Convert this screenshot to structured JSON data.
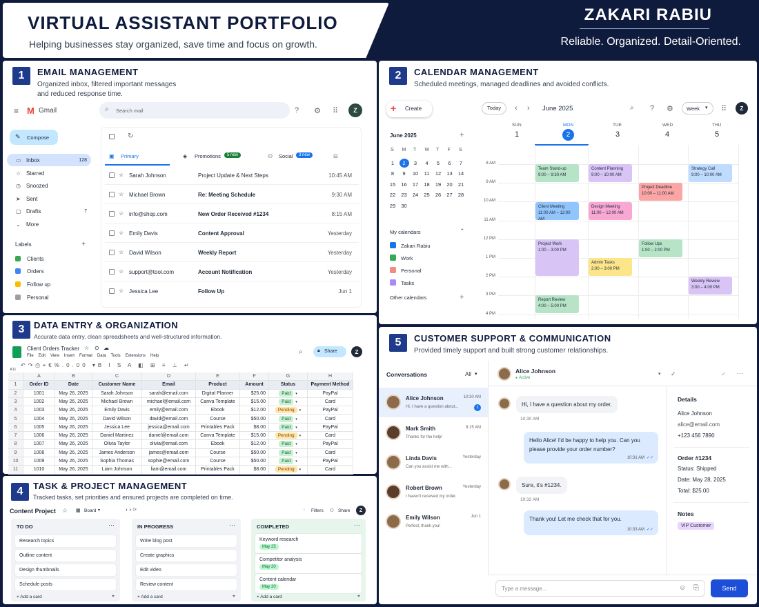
{
  "header": {
    "title": "VIRTUAL ASSISTANT PORTFOLIO",
    "subtitle": "Helping businesses stay organized, save time and focus on growth.",
    "name": "ZAKARI RABIU",
    "tagline": "Reliable. Organized. Detail-Oriented."
  },
  "p1": {
    "num": "1",
    "title": "EMAIL MANAGEMENT",
    "desc1": "Organized inbox, filtered important messages",
    "desc2": "and reduced response time.",
    "app": "Gmail",
    "search": "Search mail",
    "avatar": "Z",
    "compose": "Compose",
    "nav": [
      {
        "label": "Inbox",
        "count": "128"
      },
      {
        "label": "Starred",
        "count": ""
      },
      {
        "label": "Snoozed",
        "count": ""
      },
      {
        "label": "Sent",
        "count": ""
      },
      {
        "label": "Drafts",
        "count": "7"
      },
      {
        "label": "More",
        "count": ""
      }
    ],
    "labels_title": "Labels",
    "labels": [
      {
        "label": "Clients",
        "color": "#34a853"
      },
      {
        "label": "Orders",
        "color": "#4285f4"
      },
      {
        "label": "Follow up",
        "color": "#fbbc04"
      },
      {
        "label": "Personal",
        "color": "#9e9e9e"
      }
    ],
    "tabs": {
      "primary": "Primary",
      "promotions": "Promotions",
      "promo_badge": "5 new",
      "social": "Social",
      "social_badge": "3 new"
    },
    "mails": [
      {
        "from": "Sarah Johnson",
        "subject": "Project Update & Next Steps",
        "time": "10:45 AM"
      },
      {
        "from": "Michael Brown",
        "subject": "Re: Meeting Schedule",
        "time": "9:30 AM"
      },
      {
        "from": "info@shop.com",
        "subject": "New Order Received #1234",
        "time": "8:15 AM"
      },
      {
        "from": "Emily Davis",
        "subject": "Content Approval",
        "time": "Yesterday"
      },
      {
        "from": "David Wilson",
        "subject": "Weekly Report",
        "time": "Yesterday"
      },
      {
        "from": "support@tool.com",
        "subject": "Account Notification",
        "time": "Yesterday"
      },
      {
        "from": "Jessica Lee",
        "subject": "Follow Up",
        "time": "Jun 1"
      }
    ]
  },
  "p2": {
    "num": "2",
    "title": "CALENDAR MANAGEMENT",
    "desc": "Scheduled meetings, managed deadlines and avoided conflicts.",
    "create": "Create",
    "today": "Today",
    "month": "June 2025",
    "view": "Week",
    "avatar": "Z",
    "mini_month": "June 2025",
    "dow": [
      "S",
      "M",
      "T",
      "W",
      "T",
      "F",
      "S"
    ],
    "weeks": [
      [
        "1",
        "2",
        "3",
        "4",
        "5",
        "6",
        "7"
      ],
      [
        "8",
        "9",
        "10",
        "11",
        "12",
        "13",
        "14"
      ],
      [
        "15",
        "16",
        "17",
        "18",
        "19",
        "20",
        "21"
      ],
      [
        "22",
        "23",
        "24",
        "25",
        "26",
        "27",
        "28"
      ],
      [
        "29",
        "30",
        "",
        "",
        "",
        "",
        ""
      ]
    ],
    "my_calendars": "My calendars",
    "calendars": [
      {
        "label": "Zakari Rabiu",
        "color": "#1a73e8"
      },
      {
        "label": "Work",
        "color": "#34a853"
      },
      {
        "label": "Personal",
        "color": "#f28b82"
      },
      {
        "label": "Tasks",
        "color": "#a78bfa"
      }
    ],
    "other_calendars": "Other calendars",
    "days": [
      {
        "dow": "SUN",
        "date": "1"
      },
      {
        "dow": "MON",
        "date": "2"
      },
      {
        "dow": "TUE",
        "date": "3"
      },
      {
        "dow": "WED",
        "date": "4"
      },
      {
        "dow": "THU",
        "date": "5"
      }
    ],
    "hours": [
      "8 AM",
      "9 AM",
      "10 AM",
      "11 AM",
      "12 PM",
      "1 PM",
      "2 PM",
      "3 PM",
      "4 PM",
      "5 PM"
    ],
    "events": [
      {
        "title": "Team Stand-up",
        "time": "9:00 – 9:30 AM",
        "color": "#b7e4c7"
      },
      {
        "title": "Content Planning",
        "time": "9:00 – 10:00 AM",
        "color": "#d8c4f5"
      },
      {
        "title": "Strategy Call",
        "time": "9:00 – 10:00 AM",
        "color": "#bfdbfe"
      },
      {
        "title": "Project Deadline",
        "time": "10:00 – 11:00 AM",
        "color": "#fca5a5"
      },
      {
        "title": "Client Meeting",
        "time": "11:00 AM – 12:00 AM",
        "color": "#93c5fd"
      },
      {
        "title": "Design Meeting",
        "time": "11:00 – 12:00 AM",
        "color": "#f9a8d4"
      },
      {
        "title": "Project Work",
        "time": "1:00 – 3:00 PM",
        "color": "#d8c4f5"
      },
      {
        "title": "Follow Ups",
        "time": "1:00 – 2:00 PM",
        "color": "#b7e4c7"
      },
      {
        "title": "Admin Tasks",
        "time": "2:00 – 3:00 PM",
        "color": "#fde68a"
      },
      {
        "title": "Weekly Review",
        "time": "3:00 – 4:00 PM",
        "color": "#d8c4f5"
      },
      {
        "title": "Report Review",
        "time": "4:00 – 5:00 PM",
        "color": "#b7e4c7"
      }
    ]
  },
  "p3": {
    "num": "3",
    "title": "DATA ENTRY & ORGANIZATION",
    "desc": "Accurate data entry, clean spreadsheets and well-structured information.",
    "doc": "Client Orders Tracker",
    "menus": [
      "File",
      "Edit",
      "View",
      "Insert",
      "Format",
      "Data",
      "Tools",
      "Extensions",
      "Help"
    ],
    "share": "Share",
    "avatar": "Z",
    "cellref": "A11",
    "cols": [
      "A",
      "B",
      "C",
      "D",
      "E",
      "F",
      "G",
      "H"
    ],
    "headers": [
      "Order ID",
      "Date",
      "Customer Name",
      "Email",
      "Product",
      "Amount",
      "Status",
      "Payment Method"
    ],
    "rows": [
      [
        "1001",
        "May 26, 2025",
        "Sarah Johnson",
        "sarah@email.com",
        "Digital Planner",
        "$25.00",
        "Paid",
        "PayPal"
      ],
      [
        "1002",
        "May 26, 2025",
        "Michael Brown",
        "michael@email.com",
        "Canva Template",
        "$15.00",
        "Paid",
        "Card"
      ],
      [
        "1003",
        "May 26, 2025",
        "Emily Davis",
        "emily@email.com",
        "Ebook",
        "$12.00",
        "Pending",
        "PayPal"
      ],
      [
        "1004",
        "May 26, 2025",
        "David Wilson",
        "david@email.com",
        "Course",
        "$50.00",
        "Paid",
        "Card"
      ],
      [
        "1005",
        "May 26, 2025",
        "Jessica Lee",
        "jessica@email.com",
        "Printables Pack",
        "$8.00",
        "Paid",
        "PayPal"
      ],
      [
        "1006",
        "May 26, 2025",
        "Daniel Martinez",
        "daniel@email.com",
        "Canva Template",
        "$15.00",
        "Pending",
        "Card"
      ],
      [
        "1007",
        "May 26, 2025",
        "Olivia Taylor",
        "olivia@email.com",
        "Ebook",
        "$12.00",
        "Paid",
        "PayPal"
      ],
      [
        "1008",
        "May 26, 2025",
        "James Anderson",
        "james@email.com",
        "Course",
        "$50.00",
        "Paid",
        "Card"
      ],
      [
        "1009",
        "May 26, 2025",
        "Sophia Thomas",
        "sophie@email.com",
        "Course",
        "$50.00",
        "Paid",
        "PayPal"
      ],
      [
        "1010",
        "May 26, 2025",
        "Liam Johnson",
        "liam@email.com",
        "Printables Pack",
        "$8.00",
        "Pending",
        "Card"
      ]
    ]
  },
  "p4": {
    "num": "4",
    "title": "TASK & PROJECT MANAGEMENT",
    "desc": "Tracked tasks, set priorities and ensured projects are completed on time.",
    "project": "Content Project",
    "board": "Board",
    "filters": "Filters",
    "share": "Share",
    "avatar": "Z",
    "add": "+ Add a card",
    "columns": [
      {
        "title": "TO DO",
        "cards": [
          {
            "t": "Research topics"
          },
          {
            "t": "Outline content"
          },
          {
            "t": "Design thumbnails"
          },
          {
            "t": "Schedule posts"
          }
        ]
      },
      {
        "title": "IN PROGRESS",
        "cards": [
          {
            "t": "Write blog post"
          },
          {
            "t": "Create graphics"
          },
          {
            "t": "Edit video"
          },
          {
            "t": "Review content"
          }
        ]
      },
      {
        "title": "COMPLETED",
        "cards": [
          {
            "t": "Keyword research",
            "tag": "May 25"
          },
          {
            "t": "Competitor analysis",
            "tag": "May 20"
          },
          {
            "t": "Content calendar",
            "tag": "May 20"
          }
        ]
      }
    ]
  },
  "p5": {
    "num": "5",
    "title": "CUSTOMER SUPPORT & COMMUNICATION",
    "desc": "Provided timely support and built strong customer relationships.",
    "conversations": "Conversations",
    "filter": "All",
    "convs": [
      {
        "name": "Alice Johnson",
        "time": "10:30 AM",
        "preview": "Hi, I have a question about...",
        "badge": "1"
      },
      {
        "name": "Mark Smith",
        "time": "9:15 AM",
        "preview": "Thanks for the help!"
      },
      {
        "name": "Linda Davis",
        "time": "Yesterday",
        "preview": "Can you assist me with..."
      },
      {
        "name": "Robert Brown",
        "time": "Yesterday",
        "preview": "I haven't received my order."
      },
      {
        "name": "Emily Wilson",
        "time": "Jun 1",
        "preview": "Perfect, thank you!"
      }
    ],
    "chat_name": "Alice Johnson",
    "chat_status": "Active",
    "msgs": [
      {
        "text": "Hi, I have a question about my order.",
        "time": "10:30 AM"
      },
      {
        "text1": "Hello Alice! I'd be happy to help you. Can you",
        "text2": "please provide your order number?",
        "time": "10:31 AM"
      },
      {
        "text": "Sure, it's #1234.",
        "time": "10:32 AM"
      },
      {
        "text": "Thank you! Let me check that for you.",
        "time": "10:33 AM"
      }
    ],
    "details": {
      "title": "Details",
      "name": "Alice Johnson",
      "email": "alice@email.com",
      "phone": "+123 456 7890",
      "order": "Order #1234",
      "status": "Status: Shipped",
      "date": "Date: May 28, 2025",
      "total": "Total: $25.00",
      "notes": "Notes",
      "tag": "VIP Customer"
    },
    "placeholder": "Type a message...",
    "send": "Send"
  }
}
